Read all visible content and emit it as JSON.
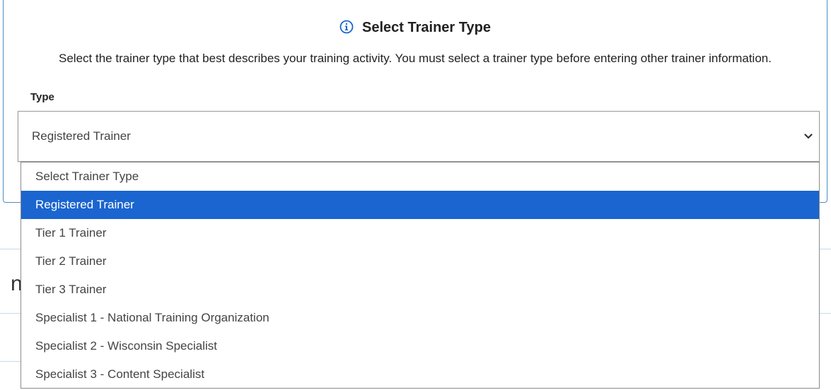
{
  "panel": {
    "heading": "Select Trainer Type",
    "description": "Select the trainer type that best describes your training activity. You must select a trainer type before entering other trainer information.",
    "icon": "info-icon"
  },
  "type_field": {
    "label": "Type",
    "selected_value": "Registered Trainer",
    "icon": "chevron-down-icon"
  },
  "dropdown": {
    "options": [
      {
        "label": "Select Trainer Type",
        "selected": false
      },
      {
        "label": "Registered Trainer",
        "selected": true
      },
      {
        "label": "Tier 1 Trainer",
        "selected": false
      },
      {
        "label": "Tier 2 Trainer",
        "selected": false
      },
      {
        "label": "Tier 3 Trainer",
        "selected": false
      },
      {
        "label": "Specialist 1 - National Training Organization",
        "selected": false
      },
      {
        "label": "Specialist 2 - Wisconsin Specialist",
        "selected": false
      },
      {
        "label": "Specialist 3 - Content Specialist",
        "selected": false
      }
    ]
  },
  "background": {
    "heading_fragment": "nt"
  },
  "colors": {
    "accent": "#1a65cf",
    "panel_border": "#4a8fc7"
  }
}
